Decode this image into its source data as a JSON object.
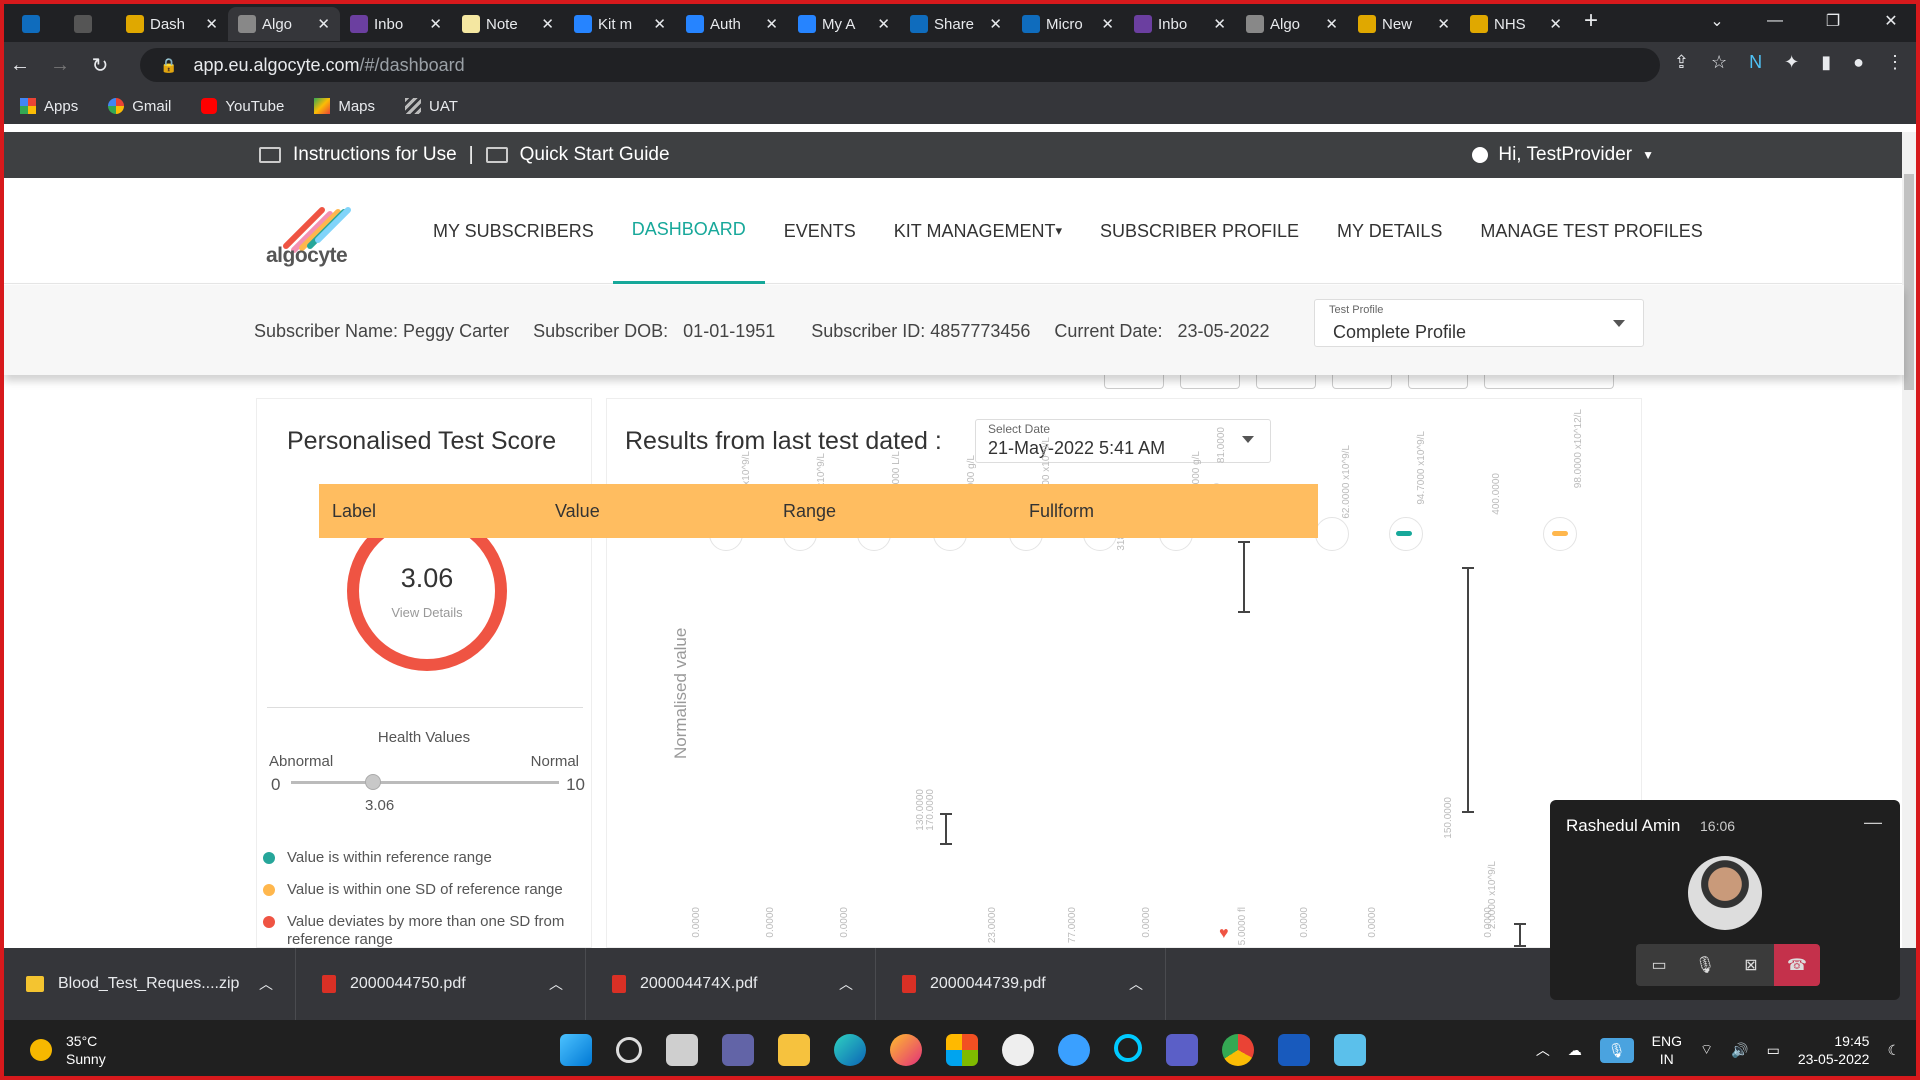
{
  "browser": {
    "tabs": [
      {
        "title": "",
        "fav": "outlook-icon",
        "color": "#0f6cbd"
      },
      {
        "title": "",
        "fav": "s-icon",
        "color": "#555"
      },
      {
        "title": "Dash",
        "fav": "chrome-icon",
        "color": "#e0a800"
      },
      {
        "title": "Algo",
        "fav": "algocyte-icon",
        "color": "#888",
        "active": true
      },
      {
        "title": "Inbo",
        "fav": "yahoo-icon",
        "color": "#6b3fa0"
      },
      {
        "title": "Note",
        "fav": "notes-icon",
        "color": "#f4e7a1"
      },
      {
        "title": "Kit m",
        "fav": "jira-icon",
        "color": "#2684ff"
      },
      {
        "title": "Auth",
        "fav": "jira-icon",
        "color": "#2684ff"
      },
      {
        "title": "My A",
        "fav": "jira-icon",
        "color": "#2684ff"
      },
      {
        "title": "Share",
        "fav": "cloud-icon",
        "color": "#0f6cbd"
      },
      {
        "title": "Micro",
        "fav": "cloud-icon",
        "color": "#0f6cbd"
      },
      {
        "title": "Inbo",
        "fav": "yahoo-icon",
        "color": "#6b3fa0"
      },
      {
        "title": "Algo",
        "fav": "algocyte-icon",
        "color": "#888"
      },
      {
        "title": "New",
        "fav": "chrome-icon",
        "color": "#e0a800"
      },
      {
        "title": "NHS",
        "fav": "google-icon",
        "color": "#e0a800"
      }
    ],
    "url_host": "app.eu.algocyte.com",
    "url_path": "/#/dashboard",
    "bookmarks": [
      "Apps",
      "Gmail",
      "YouTube",
      "Maps",
      "UAT"
    ]
  },
  "app": {
    "instructions": "Instructions for Use",
    "separator": "|",
    "quick_start": "Quick Start Guide",
    "greeting": "Hi, TestProvider",
    "logo_text": "algocyte",
    "menu": [
      "MY SUBSCRIBERS",
      "DASHBOARD",
      "EVENTS",
      "KIT MANAGEMENT",
      "SUBSCRIBER PROFILE",
      "MY DETAILS",
      "MANAGE TEST PROFILES"
    ],
    "active_menu": "DASHBOARD",
    "subscriber": {
      "name": "Subscriber Name: Peggy Carter",
      "dob_label": "Subscriber DOB:",
      "dob": "01-01-1951",
      "id": "Subscriber ID: 4857773456",
      "date_label": "Current Date:",
      "date": "23-05-2022"
    },
    "test_profile_label": "Test Profile",
    "test_profile_value": "Complete Profile"
  },
  "score_card": {
    "title": "Personalised Test Score",
    "score": "3.06",
    "view_details": "View Details",
    "health_values": "Health Values",
    "abnormal": "Abnormal",
    "normal": "Normal",
    "min": "0",
    "max": "10",
    "slider_value": 3.06,
    "slider_label": "3.06",
    "legend": [
      {
        "text": "Value is within reference range",
        "color": "#26a69a"
      },
      {
        "text": "Value is within one SD of reference range",
        "color": "#ffb74d"
      },
      {
        "text": "Value deviates by more than one SD from reference range",
        "color": "#ef5443"
      }
    ]
  },
  "results": {
    "title": "Results from last test dated :",
    "select_date_label": "Select Date",
    "select_date_value": "21-May-2022 5:41 AM",
    "y_axis": "Normalised value",
    "tooltip_headers": [
      "Label",
      "Value",
      "Range",
      "Fullform"
    ],
    "top_ticks": [
      "23.0000 x10^9/L",
      "75.0000 x10^9/L",
      "475.0000 L/L",
      "500.0000 g/L",
      "213.0000 x10^9/L",
      "318.0000 pg",
      "3400.0000 g/L",
      "98.0000",
      "81.0000",
      "62.0000 x10^9/L",
      "94.7000 x10^9/L",
      "400.0000",
      "98.0000 x10^12/L"
    ],
    "mid_ticks": [
      "130.0000",
      "170.0000",
      "150.0000",
      "2.0000 x10^9/L"
    ],
    "bottom_ticks": [
      "0.0000",
      "0.0000",
      "0.0000",
      "23.0000",
      "77.0000",
      "0.0000",
      "5.0000 fl",
      "0.0000",
      "0.0000",
      "0.0000"
    ]
  },
  "downloads": [
    {
      "name": "Blood_Test_Reques....zip",
      "type": "zip"
    },
    {
      "name": "2000044750.pdf",
      "type": "pdf"
    },
    {
      "name": "200004474X.pdf",
      "type": "pdf"
    },
    {
      "name": "2000044739.pdf",
      "type": "pdf"
    }
  ],
  "taskbar": {
    "temp": "35°C",
    "weather": "Sunny",
    "lang1": "ENG",
    "lang2": "IN",
    "time": "19:45",
    "date": "23-05-2022"
  },
  "call": {
    "name": "Rashedul Amin",
    "time": "16:06"
  }
}
